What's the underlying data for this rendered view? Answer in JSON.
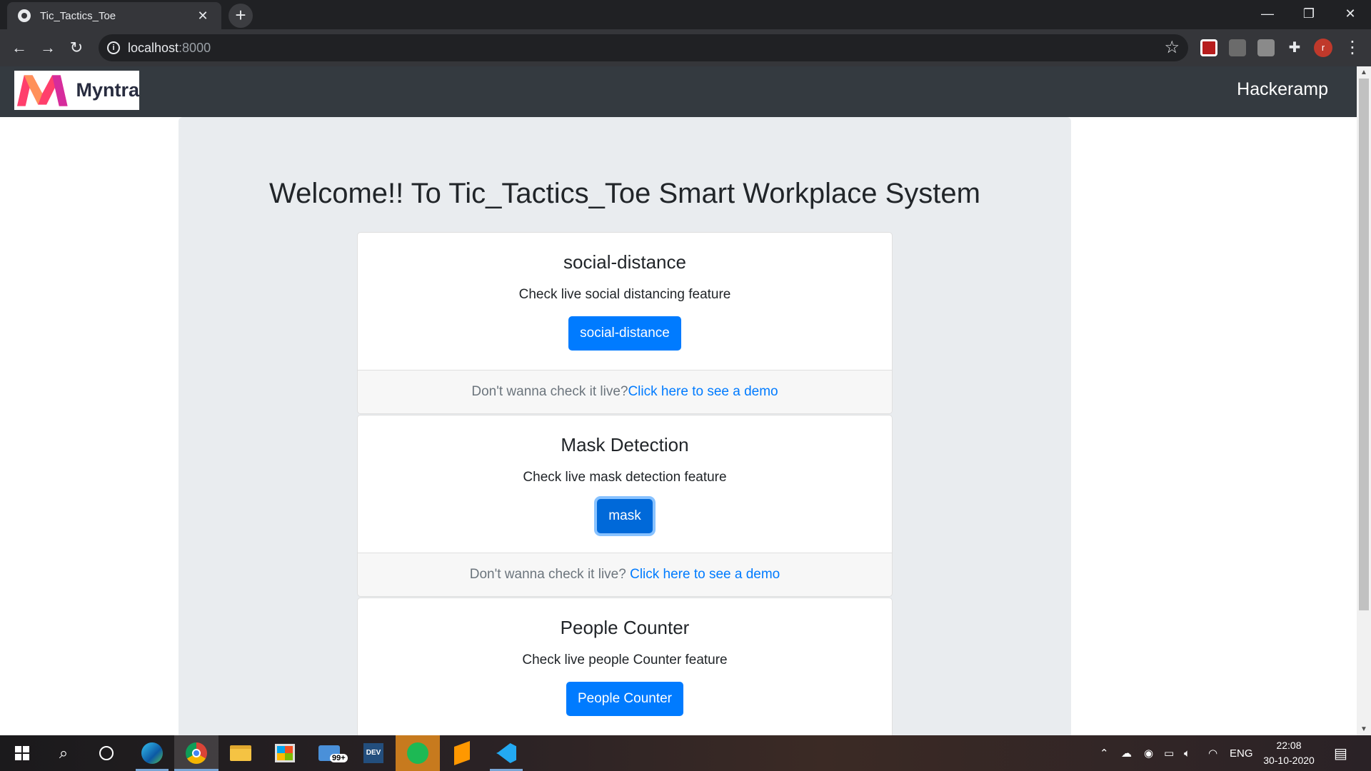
{
  "browser": {
    "tab_title": "Tic_Tactics_Toe",
    "tab_close": "✕",
    "new_tab": "+",
    "url_host": "localhost",
    "url_port": ":8000",
    "window_controls": {
      "minimize": "—",
      "restore": "❐",
      "close": "✕"
    },
    "profile_initial": "r"
  },
  "navbar": {
    "brand_name": "Myntra",
    "right_label": "Hackeramp",
    "brand_colors": {
      "pink": "#ff3f6c",
      "orange": "#ff905a",
      "purple": "#d62c9c"
    }
  },
  "page": {
    "headline": "Welcome!! To Tic_Tactics_Toe Smart Workplace System"
  },
  "cards": [
    {
      "title": "social-distance",
      "text": "Check live social distancing feature",
      "button": "social-distance",
      "footer_prefix": "Don't wanna check it live?",
      "footer_link": "Click here to see a demo"
    },
    {
      "title": "Mask Detection",
      "text": "Check live mask detection feature",
      "button": "mask",
      "footer_prefix": "Don't wanna check it live? ",
      "footer_link": "Click here to see a demo"
    },
    {
      "title": "People Counter",
      "text": "Check live people Counter feature",
      "button": "People Counter"
    }
  ],
  "taskbar": {
    "mail_badge": "99+",
    "devex_label": "DEV",
    "language": "ENG",
    "time": "22:08",
    "date": "30-10-2020"
  },
  "colors": {
    "primary": "#007bff",
    "navbar_bg": "#343a40",
    "jumbotron_bg": "#e9ecef",
    "tab_bg": "#35363a",
    "chrome_bg": "#202124"
  }
}
